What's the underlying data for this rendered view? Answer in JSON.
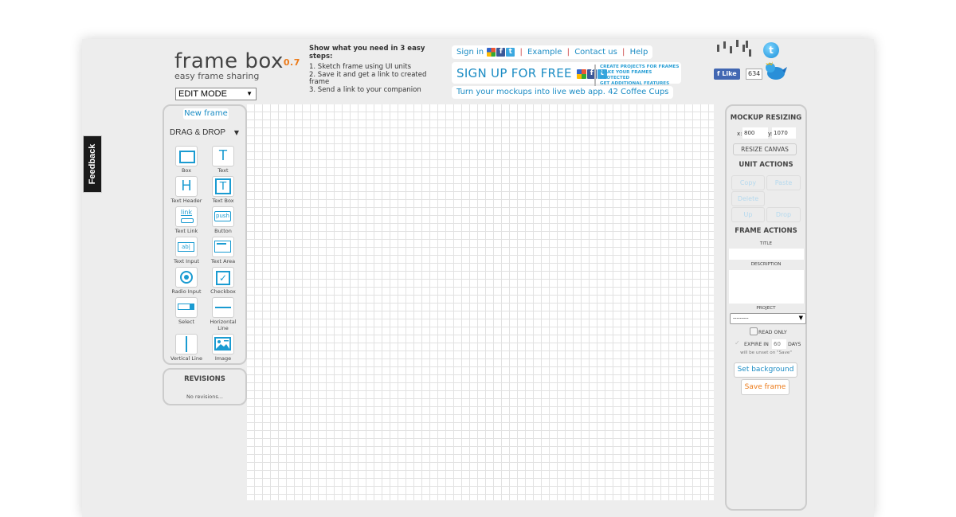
{
  "logo": {
    "title": "frame box",
    "version": "0.7",
    "subtitle": "easy frame sharing"
  },
  "mode_select": {
    "value": "EDIT MODE"
  },
  "steps": {
    "heading": "Show what you need in 3 easy steps:",
    "items": [
      "1. Sketch frame using UI units",
      "2. Save it and get a link to created frame",
      "3. Send a link to your companion"
    ]
  },
  "topnav": {
    "sign_in": "Sign in",
    "example": "Example",
    "contact": "Contact us",
    "help": "Help",
    "separator": "|"
  },
  "signup": {
    "label": "SIGN UP FOR FREE",
    "features": [
      "CREATE PROJECTS FOR FRAMES",
      "MAKE YOUR FRAMES PROTECTED",
      "GET ADDITIONAL FEATURES"
    ]
  },
  "tagline": "Turn your mockups into live web app. 42 Coffee Cups",
  "social": {
    "like_label": "Like",
    "like_count": "634",
    "twitter_glyph": "t",
    "facebook_glyph": "f"
  },
  "feedback": "Feedback",
  "left_panel": {
    "new_frame": "New frame",
    "section": "DRAG & DROP",
    "units": [
      {
        "label": "Box",
        "icon": "box-icon"
      },
      {
        "label": "Text",
        "icon": "text-icon"
      },
      {
        "label": "Text Header",
        "icon": "text-header-icon"
      },
      {
        "label": "Text Box",
        "icon": "text-box-icon"
      },
      {
        "label": "Text Link",
        "icon": "text-link-icon"
      },
      {
        "label": "Button",
        "icon": "button-icon"
      },
      {
        "label": "Text Input",
        "icon": "text-input-icon"
      },
      {
        "label": "Text Area",
        "icon": "text-area-icon"
      },
      {
        "label": "Radio Input",
        "icon": "radio-input-icon"
      },
      {
        "label": "Checkbox",
        "icon": "checkbox-icon"
      },
      {
        "label": "Select",
        "icon": "select-icon"
      },
      {
        "label": "Horizontal Line",
        "icon": "horizontal-line-icon"
      },
      {
        "label": "Vertical Line",
        "icon": "vertical-line-icon"
      },
      {
        "label": "Image",
        "icon": "image-icon"
      }
    ],
    "glyphs": {
      "text": "T",
      "header": "H",
      "link": "link",
      "push": "push",
      "input": "ab|"
    }
  },
  "revisions": {
    "title": "REVISIONS",
    "empty": "No revisions..."
  },
  "right_panel": {
    "resizing_title": "MOCKUP RESIZING",
    "x_label": "x:",
    "x_value": "800",
    "y_label": "y:",
    "y_value": "1070",
    "resize_button": "RESIZE CANVAS",
    "unit_actions_title": "UNIT ACTIONS",
    "copy": "Copy",
    "paste": "Paste",
    "delete": "Delete",
    "up": "Up",
    "drop": "Drop",
    "frame_actions_title": "FRAME ACTIONS",
    "title_label": "TITLE",
    "title_value": "",
    "description_label": "DESCRIPTION",
    "description_value": "",
    "project_label": "PROJECT",
    "project_value": "---------",
    "read_only_label": "READ ONLY",
    "read_only_checked": false,
    "expire_label": "EXPIRE IN",
    "expire_value": "60",
    "expire_unit": "DAYS",
    "expire_checked": true,
    "expire_note": "will be unset on \"Save\"",
    "set_background": "Set background",
    "save_frame": "Save frame"
  },
  "colors": {
    "link_blue": "#1b8cc4",
    "accent_orange": "#ec7a18",
    "icon_blue": "#1a9bd1"
  }
}
